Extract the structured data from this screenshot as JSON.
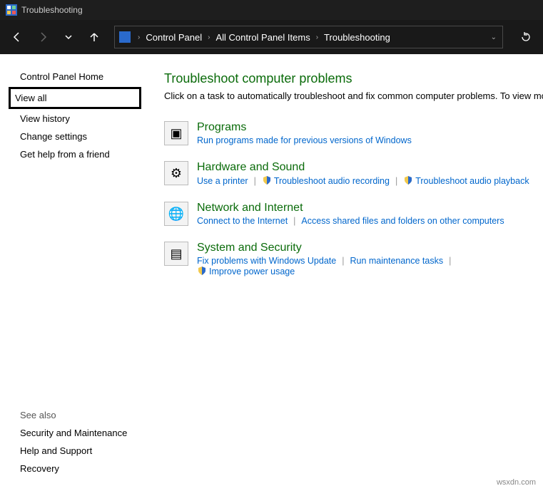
{
  "titlebar": {
    "title": "Troubleshooting"
  },
  "nav": {
    "breadcrumb": [
      {
        "label": "Control Panel"
      },
      {
        "label": "All Control Panel Items"
      },
      {
        "label": "Troubleshooting"
      }
    ]
  },
  "sidebar": {
    "items": [
      {
        "label": "Control Panel Home"
      },
      {
        "label": "View all",
        "selected": true
      },
      {
        "label": "View history"
      },
      {
        "label": "Change settings"
      },
      {
        "label": "Get help from a friend"
      }
    ],
    "see_also_head": "See also",
    "see_also": [
      {
        "label": "Security and Maintenance"
      },
      {
        "label": "Help and Support"
      },
      {
        "label": "Recovery"
      }
    ]
  },
  "main": {
    "title": "Troubleshoot computer problems",
    "subtitle": "Click on a task to automatically troubleshoot and fix common computer problems. To view more troubleshooters, click on a category or use the Search box.",
    "categories": [
      {
        "title": "Programs",
        "icon": "programs-icon",
        "links": [
          {
            "label": "Run programs made for previous versions of Windows",
            "shield": false
          }
        ]
      },
      {
        "title": "Hardware and Sound",
        "icon": "hardware-icon",
        "links": [
          {
            "label": "Use a printer",
            "shield": false
          },
          {
            "label": "Troubleshoot audio recording",
            "shield": true
          },
          {
            "label": "Troubleshoot audio playback",
            "shield": true
          }
        ]
      },
      {
        "title": "Network and Internet",
        "icon": "network-icon",
        "links": [
          {
            "label": "Connect to the Internet",
            "shield": false
          },
          {
            "label": "Access shared files and folders on other computers",
            "shield": false
          }
        ]
      },
      {
        "title": "System and Security",
        "icon": "system-icon",
        "links": [
          {
            "label": "Fix problems with Windows Update",
            "shield": false
          },
          {
            "label": "Run maintenance tasks",
            "shield": false
          },
          {
            "label": "Improve power usage",
            "shield": true
          }
        ]
      }
    ]
  },
  "watermark": "wsxdn.com"
}
